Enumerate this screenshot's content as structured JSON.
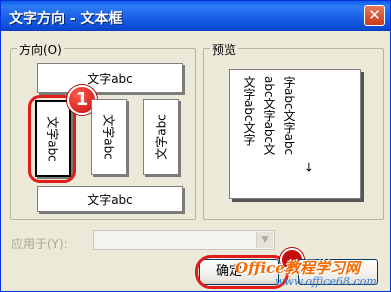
{
  "dialog": {
    "title": "文字方向 - 文本框",
    "close_glyph": "✕"
  },
  "orientation": {
    "label": "方向(O)",
    "top_option": "文字abc",
    "selected_option": "文字abc",
    "middle_option": "文字abc",
    "right_option": "文字abc",
    "bottom_option": "文字abc",
    "step1_badge": "1"
  },
  "preview": {
    "label": "预览",
    "lines": [
      "文字abc文字",
      "abc文字abc文",
      "字abc文字abc",
      "→"
    ]
  },
  "apply": {
    "label": "应用于(Y):",
    "value": ""
  },
  "buttons": {
    "ok_label": "确定",
    "cancel_label": ""
  },
  "watermark": {
    "main": "Office教程学习网",
    "sub": "www.office68.com"
  },
  "colors": {
    "title_bar": "#0c4fd8",
    "highlight_ring": "#e21b1b",
    "dialog_bg": "#ece9d8"
  }
}
